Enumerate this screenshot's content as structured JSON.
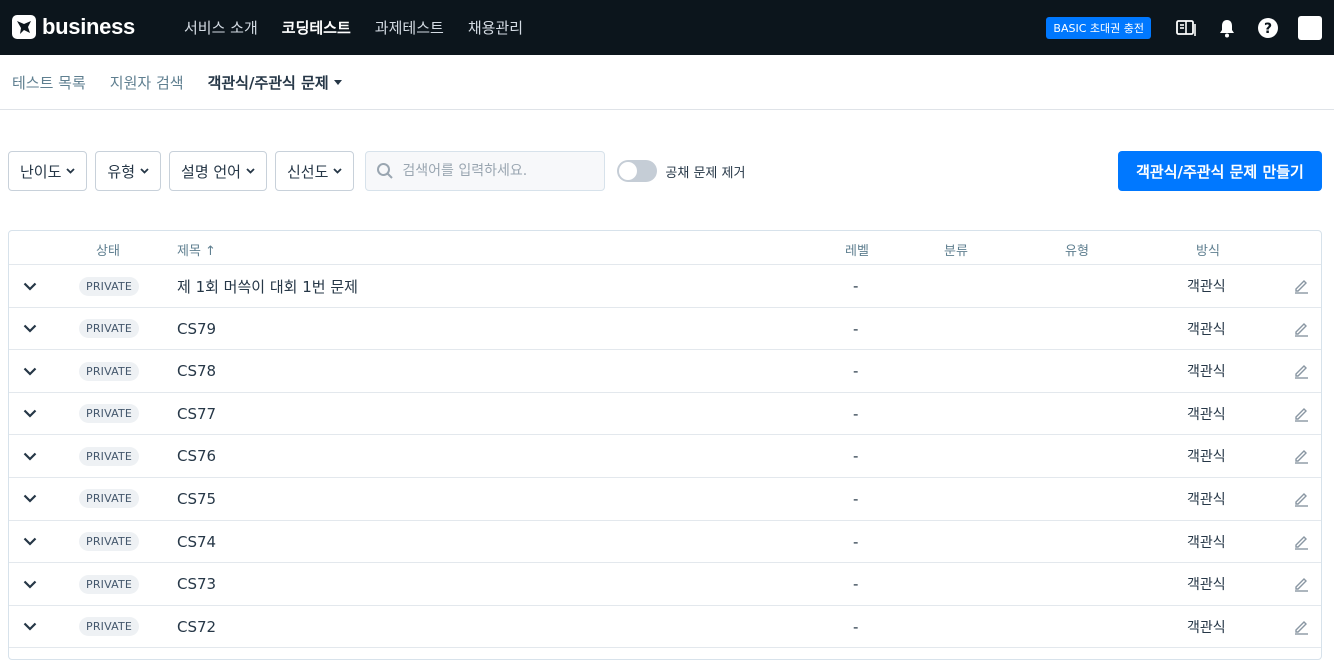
{
  "header": {
    "logo_text": "business",
    "nav": [
      {
        "label": "서비스 소개",
        "active": false
      },
      {
        "label": "코딩테스트",
        "active": true
      },
      {
        "label": "과제테스트",
        "active": false
      },
      {
        "label": "채용관리",
        "active": false
      }
    ],
    "charge_button": "BASIC 초대권 충전",
    "icons": [
      "manual-book-icon",
      "bell-icon",
      "help-icon",
      "avatar"
    ]
  },
  "subnav": {
    "items": [
      "테스트 목록",
      "지원자 검색"
    ],
    "active_item": "객관식/주관식 문제"
  },
  "filters": {
    "dropdowns": [
      "난이도",
      "유형",
      "설명 언어",
      "신선도"
    ],
    "search_placeholder": "검색어를 입력하세요.",
    "search_value": "",
    "toggle_label": "공채 문제 제거",
    "toggle_on": false,
    "create_button": "객관식/주관식 문제 만들기"
  },
  "table": {
    "headers": {
      "status": "상태",
      "title": "제목 ↑",
      "level": "레벨",
      "category": "분류",
      "type": "유형",
      "method": "방식"
    },
    "rows": [
      {
        "status": "PRIVATE",
        "title": "제 1회 머쓱이 대회 1번 문제",
        "level": "-",
        "category": "",
        "type": "",
        "method": "객관식"
      },
      {
        "status": "PRIVATE",
        "title": "CS79",
        "level": "-",
        "category": "",
        "type": "",
        "method": "객관식"
      },
      {
        "status": "PRIVATE",
        "title": "CS78",
        "level": "-",
        "category": "",
        "type": "",
        "method": "객관식"
      },
      {
        "status": "PRIVATE",
        "title": "CS77",
        "level": "-",
        "category": "",
        "type": "",
        "method": "객관식"
      },
      {
        "status": "PRIVATE",
        "title": "CS76",
        "level": "-",
        "category": "",
        "type": "",
        "method": "객관식"
      },
      {
        "status": "PRIVATE",
        "title": "CS75",
        "level": "-",
        "category": "",
        "type": "",
        "method": "객관식"
      },
      {
        "status": "PRIVATE",
        "title": "CS74",
        "level": "-",
        "category": "",
        "type": "",
        "method": "객관식"
      },
      {
        "status": "PRIVATE",
        "title": "CS73",
        "level": "-",
        "category": "",
        "type": "",
        "method": "객관식"
      },
      {
        "status": "PRIVATE",
        "title": "CS72",
        "level": "-",
        "category": "",
        "type": "",
        "method": "객관식"
      }
    ]
  },
  "colors": {
    "topbar": "#0c151c",
    "accent": "#0078ff",
    "text": "#263747",
    "muted": "#5f7f90"
  }
}
